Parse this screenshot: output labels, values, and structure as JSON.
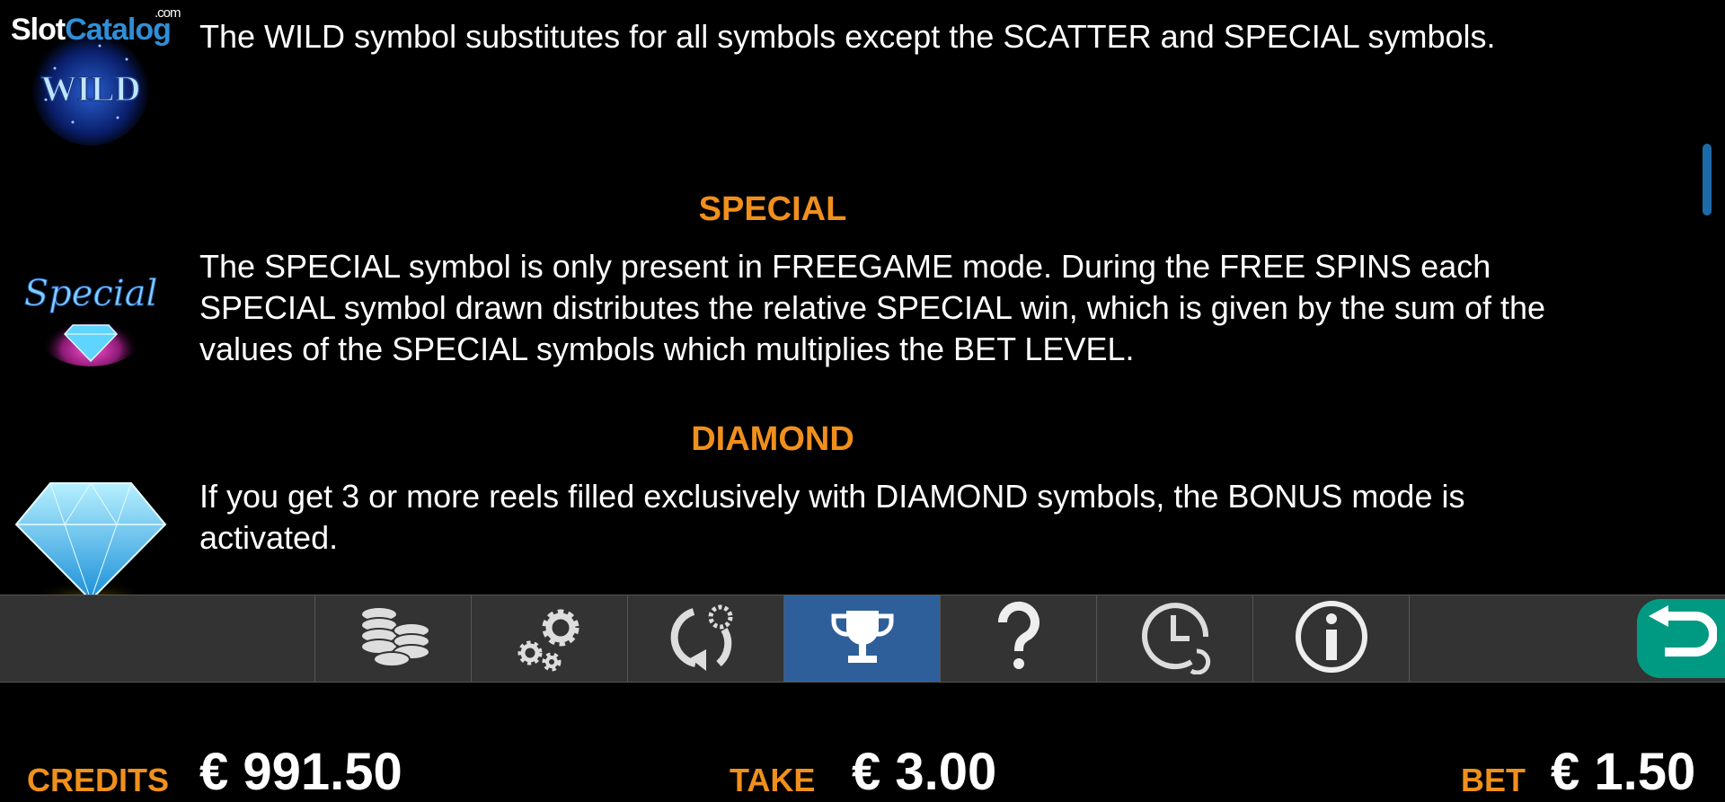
{
  "logo": {
    "slot": "Slot",
    "catalog": "Catalog",
    "com": ".com"
  },
  "symbols": [
    {
      "title": "",
      "icon": "wild-symbol-icon",
      "icon_text": "WILD",
      "description": "The WILD symbol substitutes for all symbols except the SCATTER and SPECIAL symbols."
    },
    {
      "title": "SPECIAL",
      "icon": "special-symbol-icon",
      "icon_text": "Special",
      "description": "The SPECIAL symbol is only present in FREEGAME mode. During the FREE SPINS each SPECIAL symbol drawn distributes the relative SPECIAL win, which is given by the sum of the values of the SPECIAL symbols which multiplies the BET LEVEL."
    },
    {
      "title": "DIAMOND",
      "icon": "diamond-symbol-icon",
      "description": "If you get 3 or more reels filled exclusively with DIAMOND symbols, the BONUS mode is activated."
    }
  ],
  "toolbar": {
    "items": [
      {
        "icon": "coins-icon",
        "active": false
      },
      {
        "icon": "gears-icon",
        "active": false
      },
      {
        "icon": "autoplay-icon",
        "active": false
      },
      {
        "icon": "trophy-icon",
        "active": true
      },
      {
        "icon": "help-icon",
        "active": false
      },
      {
        "icon": "history-icon",
        "active": false
      },
      {
        "icon": "info-icon",
        "active": false
      }
    ],
    "back_icon": "back-arrow-icon"
  },
  "footer": {
    "credits_label": "CREDITS",
    "credits_value": "€ 991.50",
    "take_label": "TAKE",
    "take_value": "€ 3.00",
    "bet_label": "BET",
    "bet_value": "€ 1.50"
  },
  "colors": {
    "accent_orange": "#f0901c",
    "active_tab": "#2e5f9b",
    "back_button": "#009a83",
    "toolbar_bg": "#333333"
  }
}
